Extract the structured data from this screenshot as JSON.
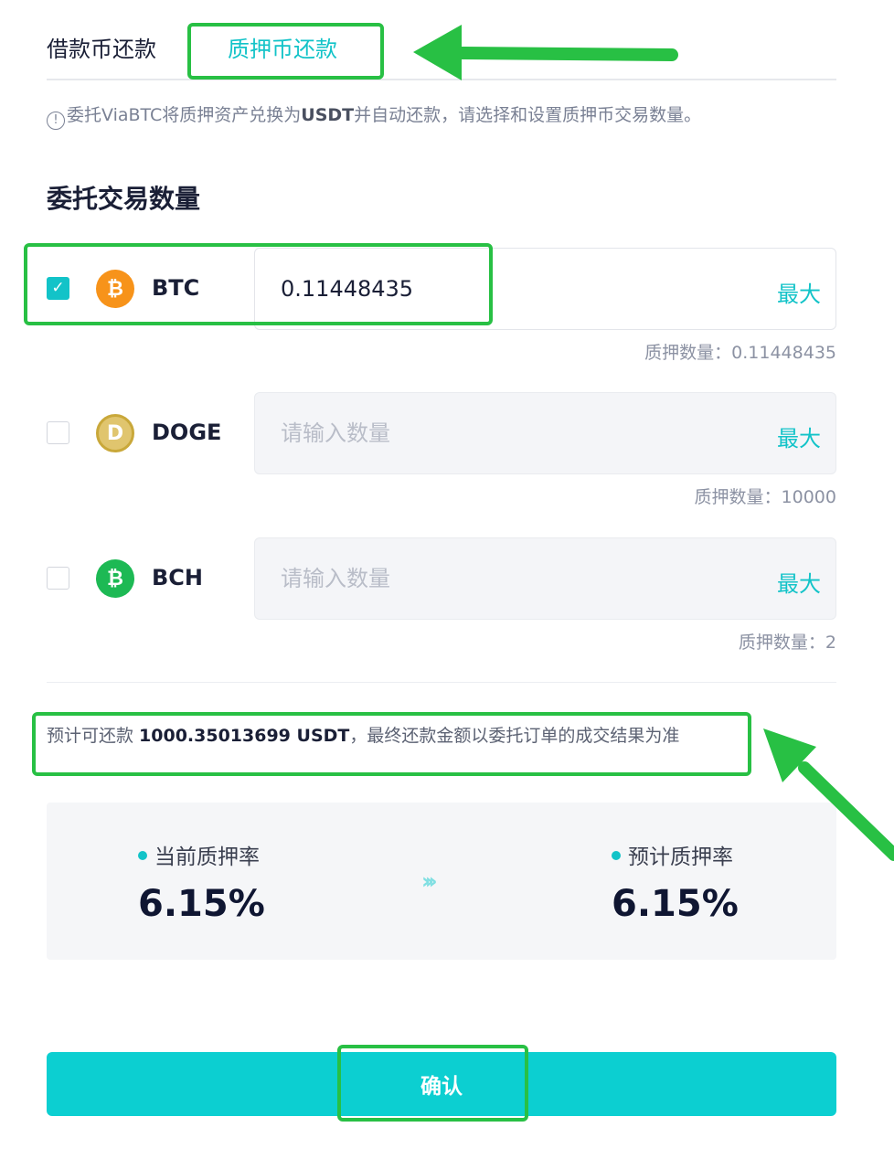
{
  "tabs": {
    "borrow_repay": "借款币还款",
    "collateral_repay": "质押币还款"
  },
  "notice": {
    "icon": "!",
    "prefix": "委托ViaBTC将质押资产兑换为",
    "currency": "USDT",
    "suffix": "并自动还款，请选择和设置质押币交易数量。"
  },
  "section_title": "委托交易数量",
  "max_label": "最大",
  "coins": [
    {
      "name": "BTC",
      "icon": "bitcoin-icon",
      "icon_glyph": "₿",
      "checked": true,
      "value": "0.11448435",
      "placeholder": "请输入数量",
      "collateral_label": "质押数量：0.11448435"
    },
    {
      "name": "DOGE",
      "icon": "dogecoin-icon",
      "icon_glyph": "D",
      "checked": false,
      "value": "",
      "placeholder": "请输入数量",
      "collateral_label": "质押数量：10000"
    },
    {
      "name": "BCH",
      "icon": "bitcoin-cash-icon",
      "icon_glyph": "₿",
      "checked": false,
      "value": "",
      "placeholder": "请输入数量",
      "collateral_label": "质押数量：2"
    }
  ],
  "estimate": {
    "prefix": "预计可还款 ",
    "amount": "1000.35013699 USDT",
    "suffix": "，最终还款金额以委托订单的成交结果为准"
  },
  "rates": {
    "current_label": "当前质押率",
    "current_value": "6.15%",
    "projected_label": "预计质押率",
    "projected_value": "6.15%",
    "arrow_glyph": "›››"
  },
  "confirm_label": "确认",
  "colors": {
    "accent": "#12c3c8",
    "button": "#0ccfd1",
    "annotation": "#28c044"
  }
}
